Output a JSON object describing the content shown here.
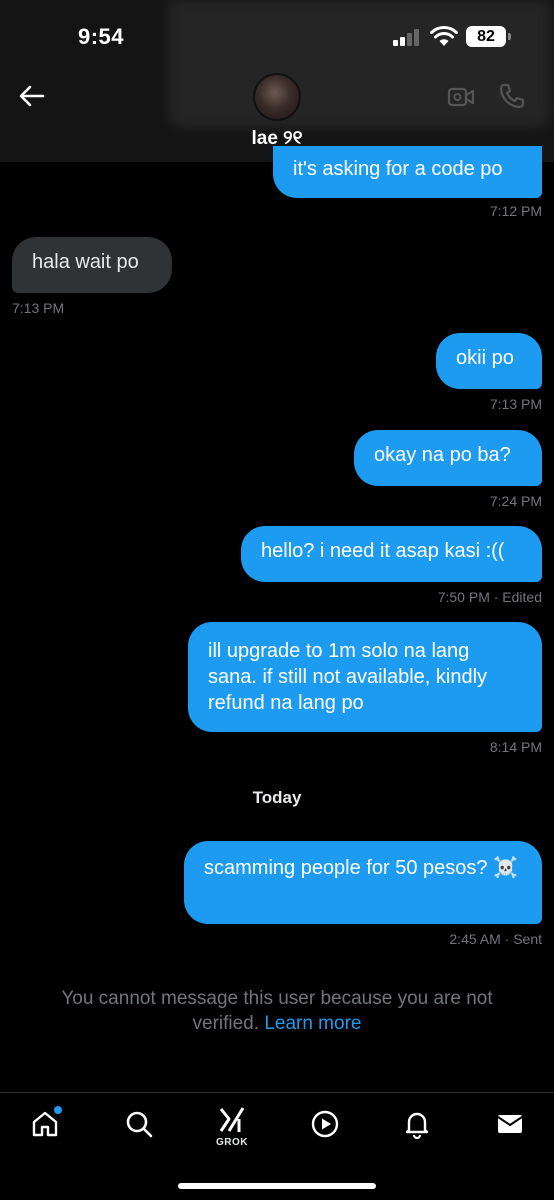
{
  "status_bar": {
    "time": "9:54",
    "battery": "82"
  },
  "header": {
    "contact_name": "lae ୨୧"
  },
  "messages": [
    {
      "text": "it's asking for a code po",
      "time": "7:12 PM"
    },
    {
      "text": "hala wait po",
      "time": "7:13 PM"
    },
    {
      "text": "okii po",
      "time": "7:13 PM"
    },
    {
      "text": "okay na po ba?",
      "time": "7:24 PM"
    },
    {
      "text": "hello? i need it asap kasi :((",
      "time": "7:50 PM · Edited"
    },
    {
      "text": "ill upgrade to 1m solo na lang sana. if still not available, kindly refund na lang po",
      "time": "8:14 PM"
    },
    {
      "text": "scamming people for 50 pesos? ☠️",
      "time": "2:45 AM · Sent"
    }
  ],
  "day_divider": "Today",
  "notice": {
    "text": "You cannot message this user because you are not verified.",
    "link": "Learn more"
  },
  "nav": {
    "grok_label": "GROK"
  },
  "colors": {
    "accent": "#1d9bf0",
    "incoming_bubble": "#2f3336",
    "muted": "#71767b"
  }
}
